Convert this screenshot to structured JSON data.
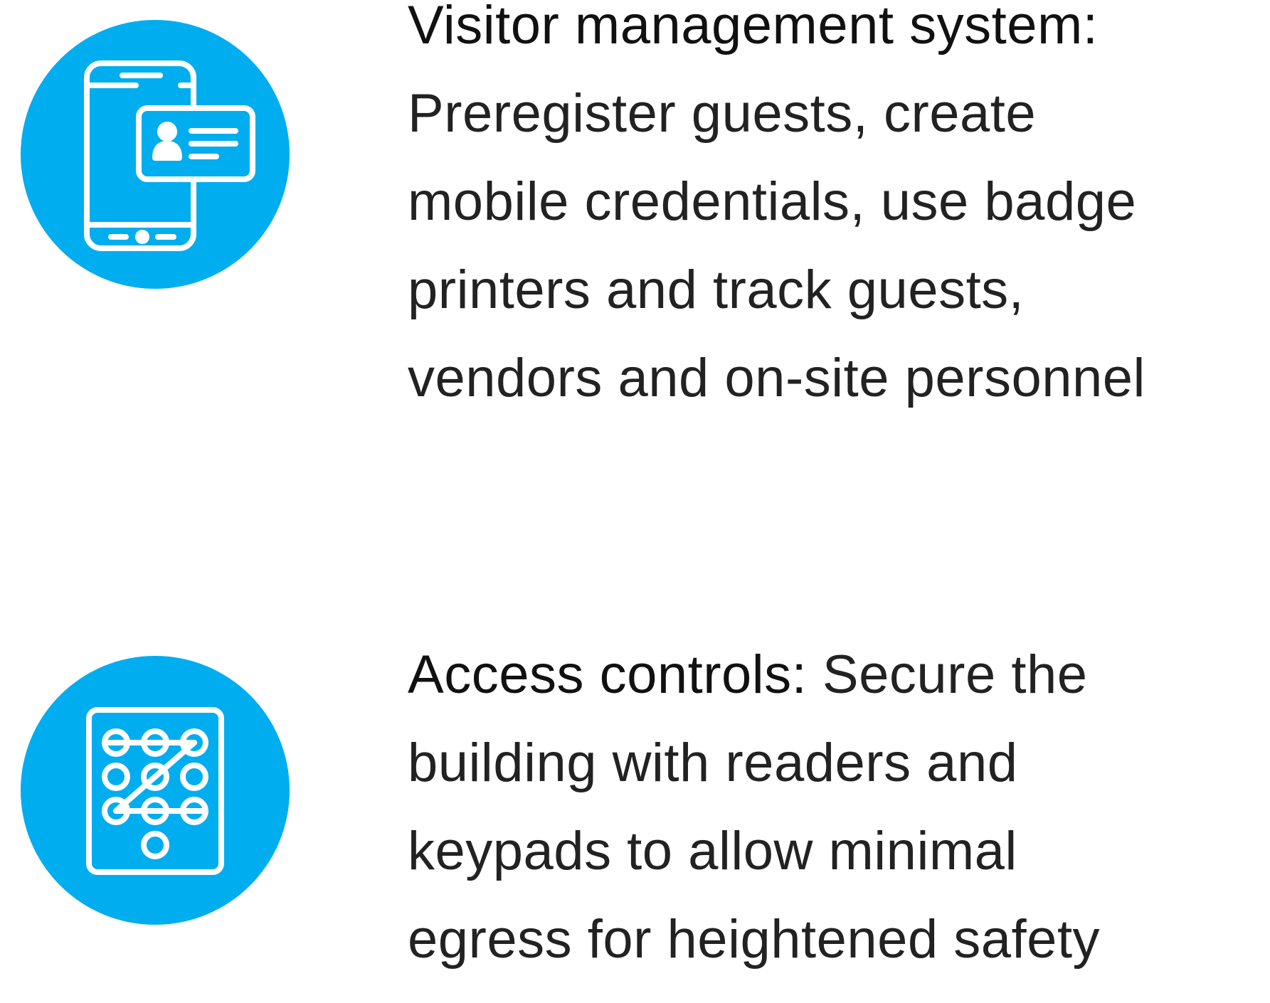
{
  "colors": {
    "accent_blue": "#00adef",
    "icon_stroke": "#ffffff",
    "text": "#222222"
  },
  "features": [
    {
      "icon": "phone-badge-icon",
      "heading": "Visitor management system:",
      "lines": [
        "Preregister guests, create",
        "mobile credentials, use badge",
        "printers and track guests,",
        "vendors and on-site personnel"
      ]
    },
    {
      "icon": "keypad-pattern-icon",
      "heading": "Access controls:",
      "first_line_rest": " Secure the",
      "lines": [
        "building with readers and",
        "keypads to allow minimal",
        "egress for heightened safety"
      ]
    }
  ]
}
